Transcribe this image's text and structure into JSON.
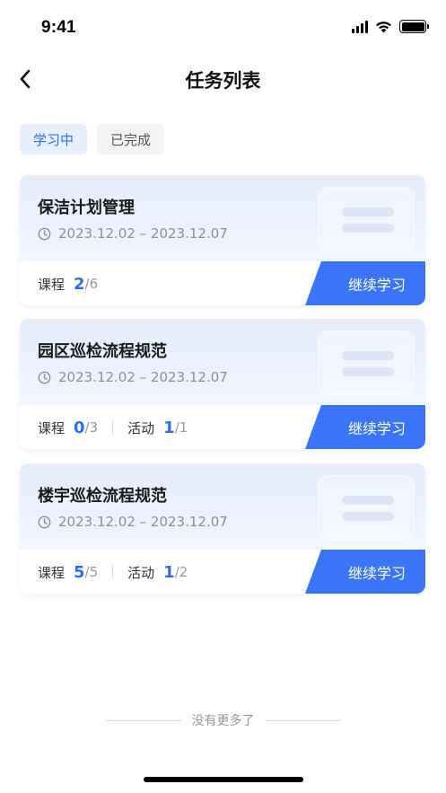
{
  "status_bar": {
    "time": "9:41"
  },
  "nav": {
    "title": "任务列表"
  },
  "tabs": [
    {
      "label": "学习中",
      "active": true
    },
    {
      "label": "已完成",
      "active": false
    }
  ],
  "tasks": [
    {
      "title": "保洁计划管理",
      "date_range": "2023.12.02 – 2023.12.07",
      "stats": [
        {
          "label": "课程",
          "done": "2",
          "total": "6"
        }
      ],
      "action": "继续学习"
    },
    {
      "title": "园区巡检流程规范",
      "date_range": "2023.12.02 – 2023.12.07",
      "stats": [
        {
          "label": "课程",
          "done": "0",
          "total": "3"
        },
        {
          "label": "活动",
          "done": "1",
          "total": "1"
        }
      ],
      "action": "继续学习"
    },
    {
      "title": "楼宇巡检流程规范",
      "date_range": "2023.12.02 – 2023.12.07",
      "stats": [
        {
          "label": "课程",
          "done": "5",
          "total": "5"
        },
        {
          "label": "活动",
          "done": "1",
          "total": "2"
        }
      ],
      "action": "继续学习"
    }
  ],
  "footer": {
    "end_text": "没有更多了"
  },
  "colors": {
    "accent": "#3a74f7",
    "tab_active_bg": "#e8efff",
    "muted": "#8c8f96"
  },
  "icons": {
    "back": "chevron-left-icon",
    "clock": "clock-icon",
    "signal": "signal-icon",
    "wifi": "wifi-icon",
    "battery": "battery-icon"
  }
}
